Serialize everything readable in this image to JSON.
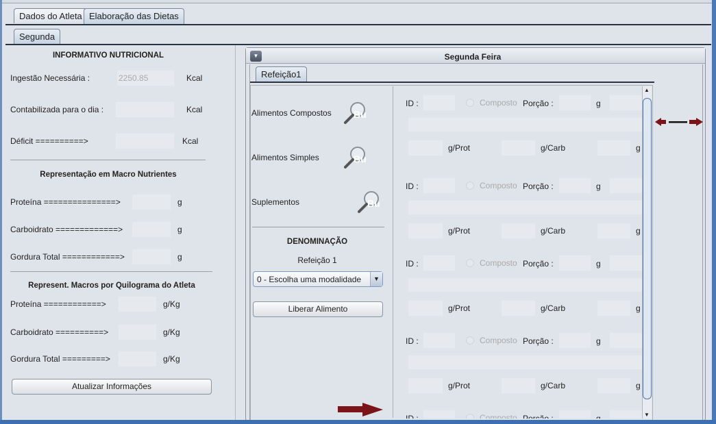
{
  "tabs": {
    "main": [
      {
        "label": "Dados do Atleta"
      },
      {
        "label": "Elaboração das Dietas"
      }
    ],
    "day": "Segunda"
  },
  "info": {
    "title": "INFORMATIVO NUTRICIONAL",
    "ingestao": {
      "label": "Ingestão Necessária :",
      "value": "2250.85",
      "unit": "Kcal"
    },
    "contabilizada": {
      "label": "Contabilizada para o dia :",
      "value": "",
      "unit": "Kcal"
    },
    "deficit": {
      "label": "Déficit ==========>",
      "value": "",
      "unit": "Kcal"
    },
    "macro_title": "Representação em Macro Nutrientes",
    "proteina": {
      "label": "Proteína ===============>",
      "unit": "g"
    },
    "carboidrato": {
      "label": "Carboidrato =============>",
      "unit": "g"
    },
    "gordura": {
      "label": "Gordura Total ============>",
      "unit": "g"
    },
    "kg_title": "Represent. Macros por Quilograma do Atleta",
    "proteina_kg": {
      "label": "Proteína ============>",
      "unit": "g/Kg"
    },
    "carboidrato_kg": {
      "label": "Carboidrato ==========>",
      "unit": "g/Kg"
    },
    "gordura_kg": {
      "label": "Gordura Total =========>",
      "unit": "g/Kg"
    },
    "update_button": "Atualizar Informações"
  },
  "day_panel": {
    "title": "Segunda Feira",
    "meal_tab": "Refeição1",
    "search": {
      "compostos": "Alimentos Compostos",
      "simples": "Alimentos Simples",
      "suplementos": "Suplementos",
      "icon_text": "Bu"
    },
    "denominacao": "DENOMINAÇÃO",
    "meal_name": "Refeição 1",
    "modalidade": "0 - Escolha uma modalidade",
    "release_button": "Liberar Alimento",
    "food_labels": {
      "id": "ID :",
      "composto": "Composto",
      "porcao": "Porção :",
      "g": "g",
      "prot": "g/Prot",
      "carb": "g/Carb",
      "g_cut": "g"
    }
  }
}
